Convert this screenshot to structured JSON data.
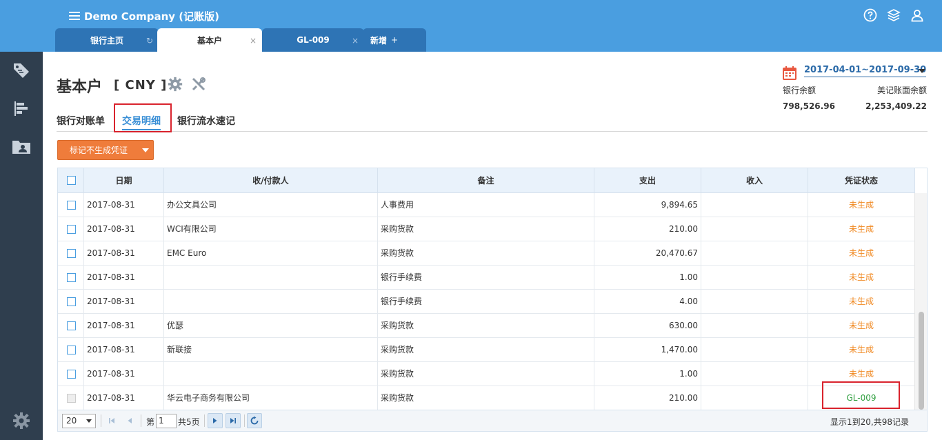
{
  "app": {
    "title": "Demo Company (记账版)"
  },
  "tabs": [
    {
      "label": "银行主页",
      "suffix": "↻"
    },
    {
      "label": "基本户",
      "suffix": "×"
    },
    {
      "label": "GL-009",
      "suffix": "×"
    },
    {
      "label": "新增",
      "suffix": "+"
    }
  ],
  "header": {
    "title": "基本户",
    "currency": "[ CNY ]"
  },
  "subtabs": [
    "银行对账单",
    "交易明细",
    "银行流水速记"
  ],
  "action": {
    "label": "标记不生成凭证"
  },
  "date_range": "2017-04-01~2017-09-30",
  "balances": {
    "bank_label": "银行余额",
    "book_label": "美记账面余额",
    "bank_value": "798,526.96",
    "book_value": "2,253,409.22"
  },
  "table": {
    "columns": [
      "日期",
      "收/付款人",
      "备注",
      "支出",
      "收入",
      "凭证状态"
    ],
    "rows": [
      {
        "date": "2017-08-31",
        "payee": "办公文具公司",
        "memo": "人事费用",
        "out": "9,894.65",
        "in": "",
        "status": "未生成"
      },
      {
        "date": "2017-08-31",
        "payee": "WCI有限公司",
        "memo": "采购货款",
        "out": "210.00",
        "in": "",
        "status": "未生成"
      },
      {
        "date": "2017-08-31",
        "payee": "EMC Euro",
        "memo": "采购货款",
        "out": "20,470.67",
        "in": "",
        "status": "未生成"
      },
      {
        "date": "2017-08-31",
        "payee": "",
        "memo": "银行手续费",
        "out": "1.00",
        "in": "",
        "status": "未生成"
      },
      {
        "date": "2017-08-31",
        "payee": "",
        "memo": "银行手续费",
        "out": "4.00",
        "in": "",
        "status": "未生成"
      },
      {
        "date": "2017-08-31",
        "payee": "优瑟",
        "memo": "采购货款",
        "out": "630.00",
        "in": "",
        "status": "未生成"
      },
      {
        "date": "2017-08-31",
        "payee": "新联接",
        "memo": "采购货款",
        "out": "1,470.00",
        "in": "",
        "status": "未生成"
      },
      {
        "date": "2017-08-31",
        "payee": "",
        "memo": "采购货款",
        "out": "1.00",
        "in": "",
        "status": "未生成"
      },
      {
        "date": "2017-08-31",
        "payee": "华云电子商务有限公司",
        "memo": "采购货款",
        "out": "210.00",
        "in": "",
        "status": "GL-009"
      }
    ]
  },
  "pager": {
    "page_size": "20",
    "page_prefix": "第",
    "page": "1",
    "page_total": "共5页",
    "info": "显示1到20,共98记录"
  },
  "colors": {
    "topbar": "#4a9ee0",
    "sidebar": "#2f3e4e",
    "accent": "#ef7c3b",
    "pending": "#f08a24",
    "done": "#2e9e3e"
  }
}
